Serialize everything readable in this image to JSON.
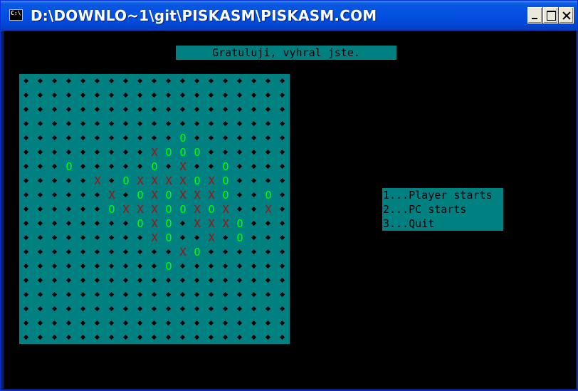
{
  "window": {
    "title": "D:\\DOWNLO~1\\git\\PISKASM\\PISKASM.COM",
    "icon": "console-icon"
  },
  "banner": "Gratuluji, vyhral jste.",
  "colors": {
    "board": "#008080",
    "x_mark": "#a01010",
    "o_mark": "#00ff00",
    "background": "#000000"
  },
  "board": {
    "rows": [
      "...................",
      "...................",
      "...................",
      "...................",
      "...........O.......",
      ".........XOOO......",
      "...O.....O.X..O....",
      ".....X.OXXXXOXO....",
      "......X.OXOXXXO..O.",
      "......OXXXOOXOX..X.",
      "........OXO.XXXO...",
      ".........XO..X.O...",
      "...........XO......",
      "..........O........",
      "...................",
      "...................",
      "...................",
      "...................",
      "..................."
    ]
  },
  "menu": {
    "items": [
      "1...Player starts",
      "2...PC starts",
      "3...Quit"
    ]
  }
}
